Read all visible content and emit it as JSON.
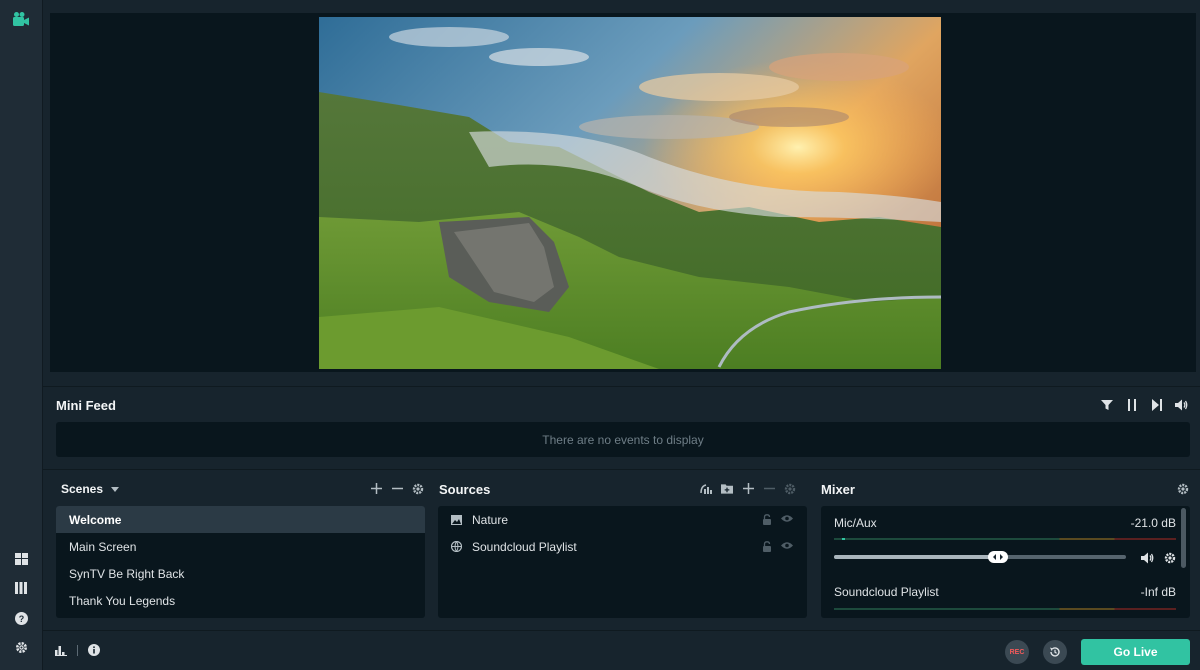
{
  "colors": {
    "accent": "#31c3a2",
    "background": "#17242d",
    "panel": "#09161d",
    "rec": "#f25a5a"
  },
  "rail": {
    "logo_icon": "video-camera-icon",
    "bottom_icons": [
      "layout-icon",
      "columns-icon",
      "help-icon",
      "settings-icon"
    ]
  },
  "mini_feed": {
    "title": "Mini Feed",
    "empty_text": "There are no events to display",
    "controls": [
      "filter-icon",
      "pause-icon",
      "skip-icon",
      "volume-icon"
    ]
  },
  "scenes": {
    "title": "Scenes",
    "items": [
      "Welcome",
      "Main Screen",
      "SynTV Be Right Back",
      "Thank You Legends"
    ],
    "selected": "Welcome"
  },
  "sources": {
    "title": "Sources",
    "items": [
      {
        "name": "Nature",
        "icon": "image-icon"
      },
      {
        "name": "Soundcloud Playlist",
        "icon": "globe-icon"
      }
    ]
  },
  "mixer": {
    "title": "Mixer",
    "channels": [
      {
        "name": "Mic/Aux",
        "db": "-21.0 dB",
        "volume": 0.56
      },
      {
        "name": "Soundcloud Playlist",
        "db": "-Inf dB"
      }
    ]
  },
  "footer": {
    "rec_label": "REC",
    "go_live_label": "Go Live"
  }
}
